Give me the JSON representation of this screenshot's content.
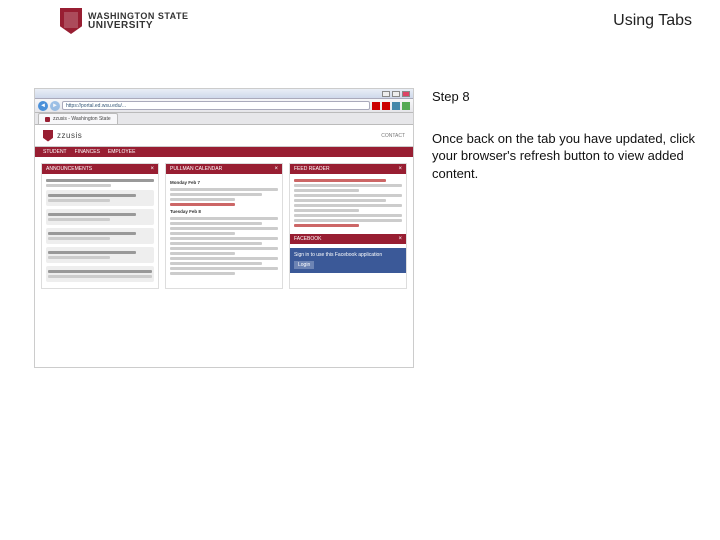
{
  "header": {
    "logo_line1": "WASHINGTON STATE",
    "logo_line2": "UNIVERSITY",
    "page_title": "Using Tabs"
  },
  "instructions": {
    "step_label": "Step 8",
    "body": "Once back on the tab you have updated, click your browser's refresh button to view added content."
  },
  "screenshot": {
    "url": "https://portal.ed.wsu.edu/...",
    "tab_label": "zzusis - Washington State",
    "brand": "zzusis",
    "site_link": "CONTACT",
    "nav_items": [
      "STUDENT",
      "FINANCES",
      "EMPLOYEE"
    ],
    "columns": {
      "left": {
        "title": "ANNOUNCEMENTS"
      },
      "middle": {
        "title": "PULLMAN CALENDAR",
        "day1": "Monday Feb 7",
        "day2": "Tuesday Feb 8"
      },
      "right": {
        "title": "FEED READER",
        "title2": "FACEBOOK",
        "fb_text": "Sign in to use this Facebook application",
        "fb_btn": "Login"
      }
    }
  }
}
